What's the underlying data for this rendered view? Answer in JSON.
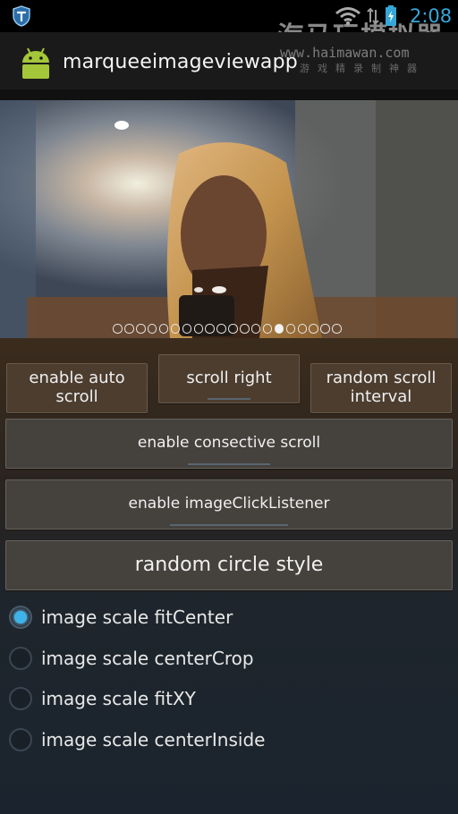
{
  "status_bar": {
    "time": "2:08",
    "watermark_title": "海马玩模拟器",
    "watermark_url": "www.haimawan.com",
    "watermark_sub": "游戏精录制神器"
  },
  "app": {
    "title": "marqueeimageviewapp"
  },
  "gallery": {
    "page_count": 20,
    "current_index": 14
  },
  "buttons": {
    "enable_auto_scroll": "enable auto\nscroll",
    "scroll_right": "scroll right",
    "random_scroll_interval": "random scroll\ninterval",
    "enable_consective_scroll": "enable consective scroll",
    "enable_image_click_listener": "enable imageClickListener",
    "random_circle_style": "random circle style"
  },
  "scale_options": [
    {
      "label": "image scale fitCenter",
      "selected": true
    },
    {
      "label": "image scale centerCrop",
      "selected": false
    },
    {
      "label": "image scale fitXY",
      "selected": false
    },
    {
      "label": "image scale centerInside",
      "selected": false
    }
  ],
  "colors": {
    "accent": "#35a7d8",
    "radio_selected": "#3db3ea"
  }
}
